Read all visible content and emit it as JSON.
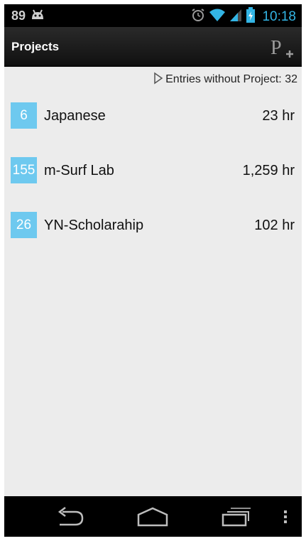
{
  "status_bar": {
    "notification_count": "89",
    "time": "10:18",
    "icons": [
      "android-notification-icon",
      "alarm-icon",
      "wifi-icon",
      "signal-icon",
      "battery-charging-icon"
    ]
  },
  "action_bar": {
    "title": "Projects",
    "add_project_icon": "add-project-icon"
  },
  "entries_without_project": {
    "label": "Entries without Project: 32"
  },
  "projects": [
    {
      "badge": "6",
      "name": "Japanese",
      "hours": "23 hr"
    },
    {
      "badge": "155",
      "name": "m-Surf Lab",
      "hours": "1,259 hr"
    },
    {
      "badge": "26",
      "name": "YN-Scholarahip",
      "hours": "102 hr"
    }
  ],
  "nav_bar": {
    "icons": [
      "back-icon",
      "home-icon",
      "recent-apps-icon",
      "overflow-menu-icon"
    ]
  },
  "colors": {
    "accent": "#33b5e5",
    "badge": "#6ec9ef",
    "background": "#ececec"
  }
}
